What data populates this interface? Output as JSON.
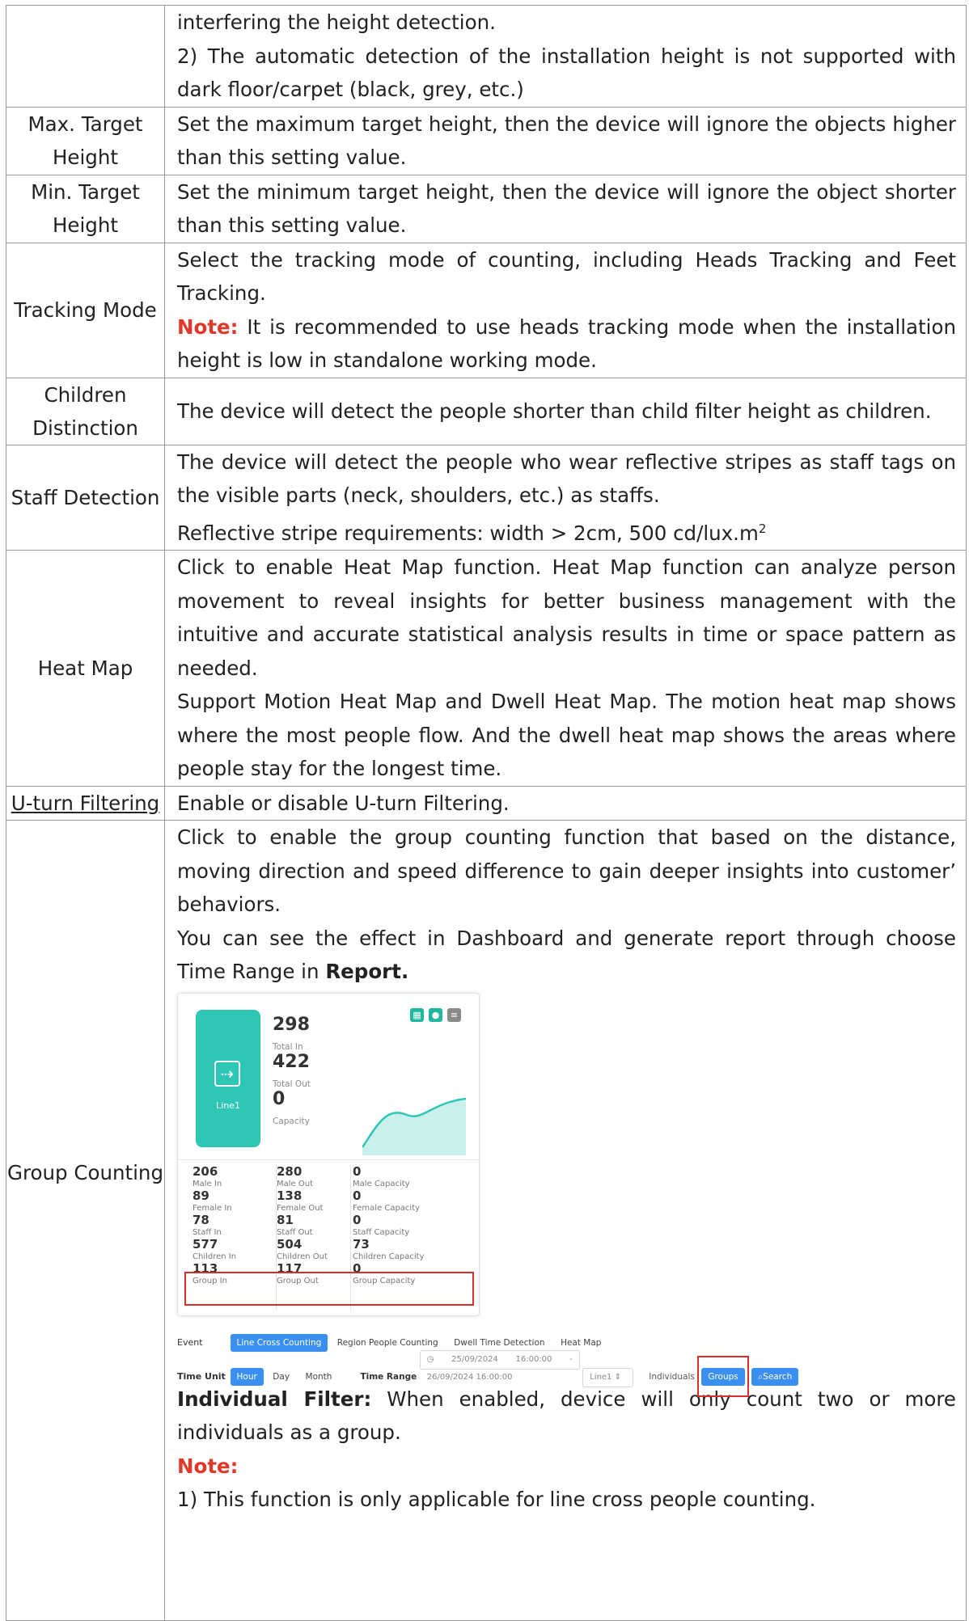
{
  "rows": [
    {
      "label": "",
      "lines": [
        "interfering the height detection.",
        "2) The automatic detection of the installation height is not supported with dark floor/carpet (black, grey, etc.)"
      ]
    },
    {
      "label": "Max. Target Height",
      "text": "Set the maximum target height, then the device will ignore the objects higher than this setting value."
    },
    {
      "label": "Min. Target Height",
      "text": "Set the minimum target height, then the device will ignore the object shorter than this setting value."
    },
    {
      "label": "Tracking Mode",
      "text": "Select the tracking mode of counting, including Heads Tracking and Feet Tracking.",
      "note_label": "Note:",
      "note_text": " It is recommended to use heads tracking mode when the installation height is low in standalone working mode."
    },
    {
      "label": "Children Distinction",
      "text": "The device will detect the people shorter than child filter height as children."
    },
    {
      "label": "Staff Detection",
      "text": "The device will detect the people who wear reflective stripes as staff tags on the visible parts (neck, shoulders, etc.) as staffs.",
      "text2": "Reflective stripe requirements: width > 2cm, 500 cd/lux.m",
      "sup": "2"
    },
    {
      "label": "Heat Map",
      "text": "Click to enable Heat Map function. Heat Map function can analyze person movement to reveal insights for better business management with the intuitive and accurate statistical analysis results in time or space pattern as needed.",
      "text2": "Support Motion Heat Map and Dwell Heat Map. The motion heat map shows where the most people flow. And the dwell heat map shows the areas where people stay for the longest time."
    },
    {
      "label": "U-turn Filtering",
      "text": "Enable or disable U-turn Filtering."
    },
    {
      "label": "Group Counting",
      "text": "Click to enable the group counting function that based on the distance, moving direction and speed difference to gain deeper insights into customer’ behaviors.",
      "text2": "You can see the effect in Dashboard and generate report through choose Time Range in ",
      "text2_bold": "Report.",
      "filter_label": "Individual Filter:",
      "filter_text": " When enabled, device will only count two or more individuals as a group.",
      "note_label": "Note:",
      "note1": "1) This function is only applicable for line cross people counting."
    }
  ],
  "card": {
    "line": "Line1",
    "total_in": "298",
    "total_in_label": "Total In",
    "total_out": "422",
    "total_out_label": "Total Out",
    "capacity": "0",
    "capacity_label": "Capacity",
    "stats": [
      [
        "206",
        "Male In",
        "280",
        "Male Out",
        "0",
        "Male Capacity"
      ],
      [
        "89",
        "Female In",
        "138",
        "Female Out",
        "0",
        "Female Capacity"
      ],
      [
        "78",
        "Staff In",
        "81",
        "Staff Out",
        "0",
        "Staff Capacity"
      ],
      [
        "577",
        "Children In",
        "504",
        "Children Out",
        "73",
        "Children Capacity"
      ],
      [
        "113",
        "Group In",
        "117",
        "Group Out",
        "0",
        "Group Capacity"
      ]
    ]
  },
  "controls": {
    "event_label": "Event",
    "tabs": [
      "Line Cross Counting",
      "Region People Counting",
      "Dwell Time Detection",
      "Heat Map"
    ],
    "time_unit_label": "Time Unit",
    "units": [
      "Hour",
      "Day",
      "Month"
    ],
    "time_range_label": "Time Range",
    "time_range_value": "25/09/2024 16:00:00  -  26/09/2024 16:00:00",
    "line_select": "Line1",
    "individuals_label": "Individuals",
    "groups_label": "Groups",
    "search_label": "Search"
  }
}
